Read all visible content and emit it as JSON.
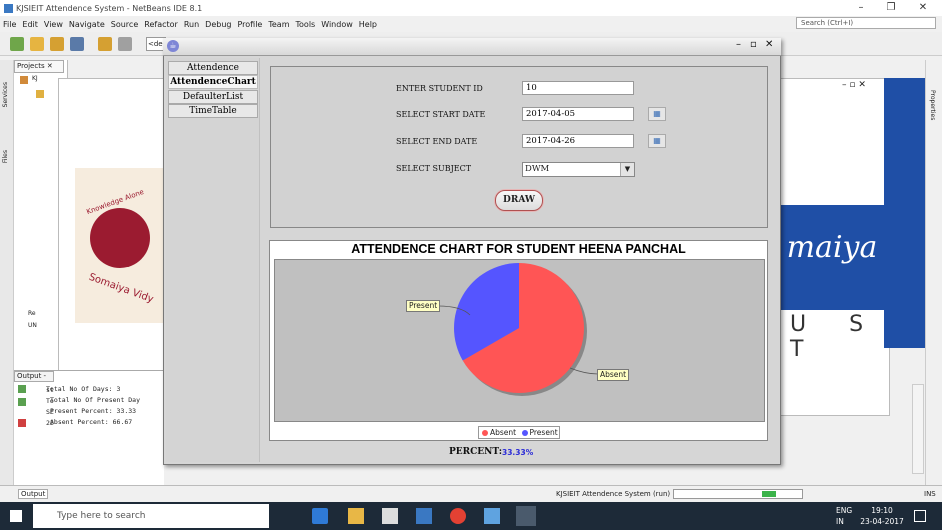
{
  "window": {
    "title": "KJSIEIT Attendence System - NetBeans IDE 8.1"
  },
  "menu": [
    "File",
    "Edit",
    "View",
    "Navigate",
    "Source",
    "Refactor",
    "Run",
    "Debug",
    "Profile",
    "Team",
    "Tools",
    "Window",
    "Help"
  ],
  "search": {
    "placeholder": "Search (Ctrl+I)"
  },
  "toolbar": {
    "config_value": "<de"
  },
  "sidebars": {
    "left_items": [
      "Services",
      "Files"
    ],
    "right_items": [
      "Properties"
    ]
  },
  "projects": {
    "tab_label": "Projects",
    "tree_label": "KJ",
    "tree_items": [
      "Re",
      "UN"
    ]
  },
  "output": {
    "tab_label": "Output -",
    "lines": [
      "st",
      "To",
      "SE",
      "22",
      "Total No Of Days: 3",
      "Total No Of Present Day",
      "Present Percent: 33.33",
      "Absent Percent: 66.67"
    ]
  },
  "logos": {
    "left_text": [
      "Knowledge Alone",
      "Somaiya Vidy"
    ],
    "right_text": "maiya",
    "ust": "U S T"
  },
  "app": {
    "tabs": [
      {
        "label": "Attendence",
        "selected": false
      },
      {
        "label": "AttendenceChart",
        "selected": true
      },
      {
        "label": "DefaulterList",
        "selected": false
      },
      {
        "label": "TimeTable",
        "selected": false
      }
    ],
    "form": {
      "student_id_label": "ENTER STUDENT ID",
      "student_id": "10",
      "start_label": "SELECT START DATE",
      "start_date": "2017-04-05",
      "end_label": "SELECT END DATE",
      "end_date": "2017-04-26",
      "subject_label": "SELECT SUBJECT",
      "subject": "DWM",
      "draw_label": "DRAW"
    },
    "percent_label": "PERCENT:",
    "percent_value": "33.33%"
  },
  "chart_data": {
    "type": "pie",
    "title": "ATTENDENCE CHART FOR STUDENT HEENA PANCHAL",
    "slices": [
      {
        "label": "Absent",
        "value": 66.67,
        "color": "#ff5555"
      },
      {
        "label": "Present",
        "value": 33.33,
        "color": "#5555ff"
      }
    ],
    "legend": [
      "Absent",
      "Present"
    ],
    "legend_position": "bottom"
  },
  "status": {
    "project_run": "KJSIEIT Attendence System (run)",
    "ins": "INS",
    "output_tab": "Output"
  },
  "taskbar": {
    "search_placeholder": "Type here to search",
    "lang": "ENG",
    "lang_sub": "IN",
    "time": "19:10",
    "date": "23-04-2017"
  }
}
